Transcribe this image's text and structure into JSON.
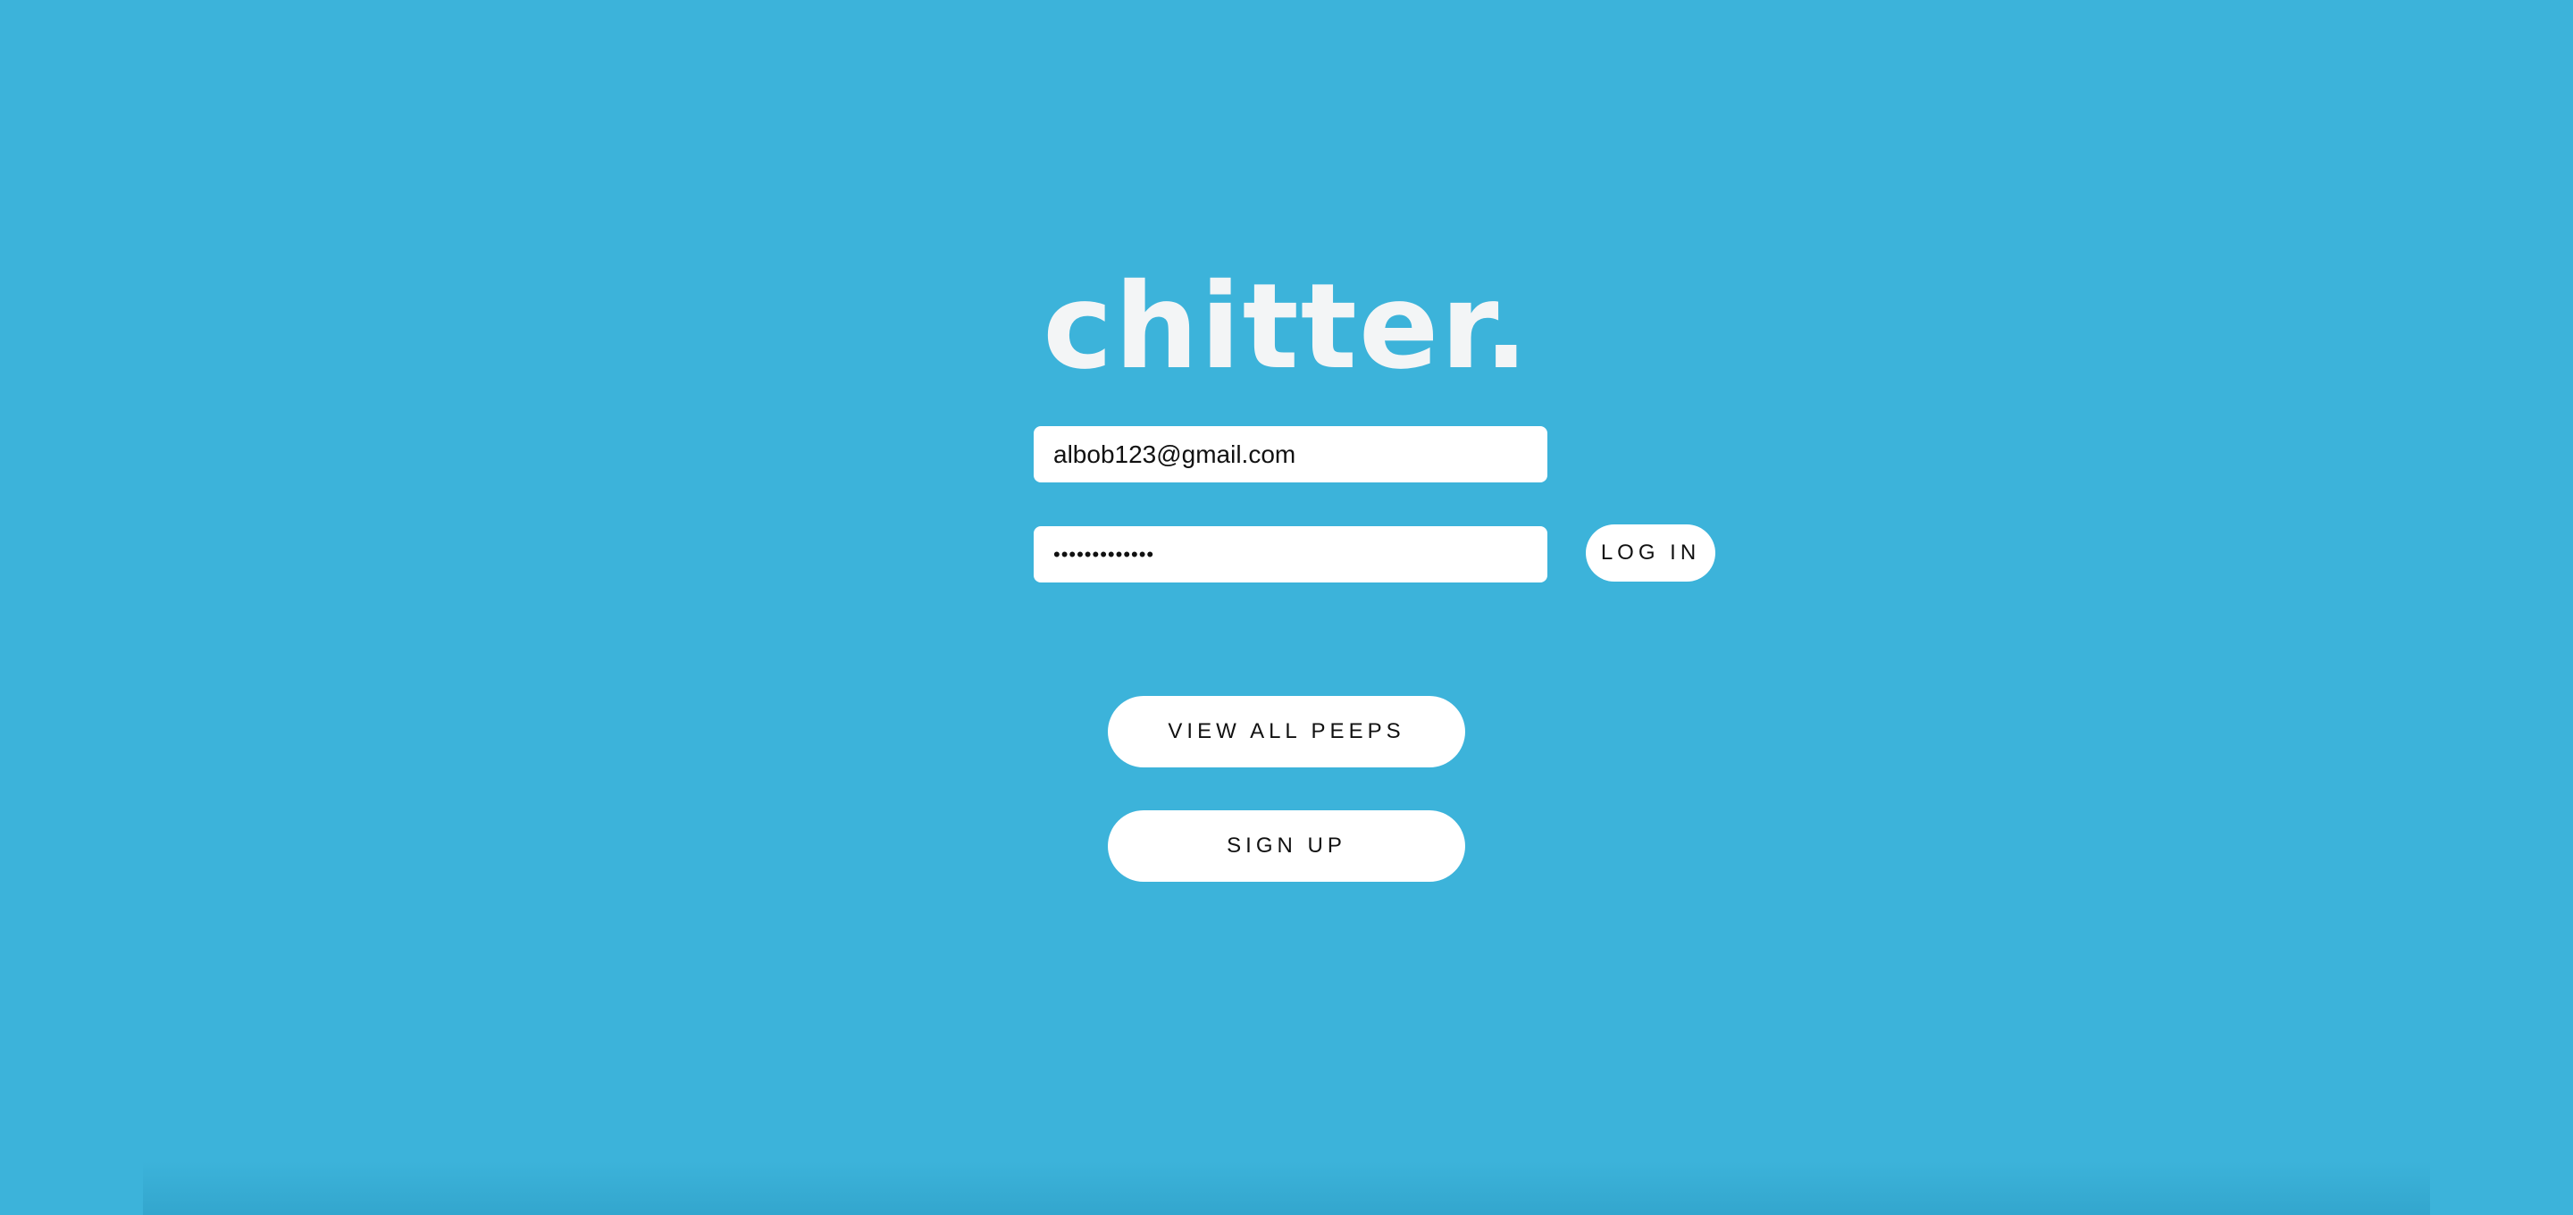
{
  "app": {
    "logo_text": "chitter."
  },
  "login_form": {
    "email_value": "albob123@gmail.com",
    "password_value": "•••••••••••••",
    "login_label": "LOG IN"
  },
  "actions": {
    "view_all_label": "VIEW ALL PEEPS",
    "signup_label": "SIGN UP"
  },
  "colors": {
    "background": "#3cb3da",
    "logo": "#f3f5f6",
    "button": "#ffffff"
  }
}
